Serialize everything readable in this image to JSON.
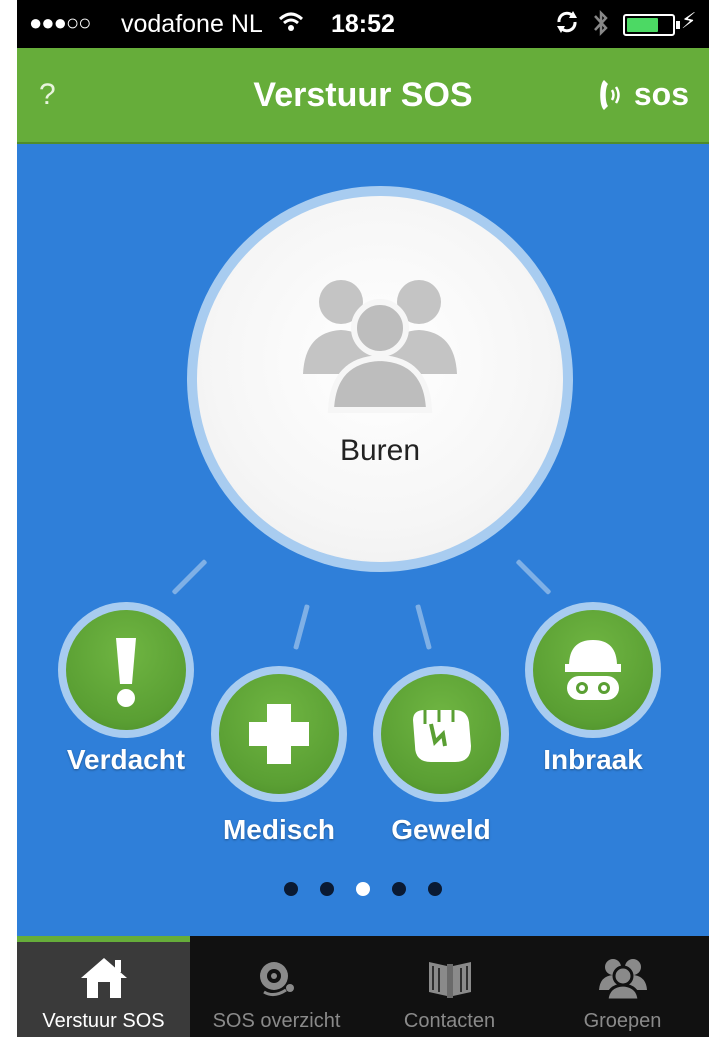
{
  "status_bar": {
    "signal": "●●●○○",
    "carrier": "vodafone NL",
    "time": "18:52",
    "battery_level": 0.7
  },
  "nav": {
    "help_label": "?",
    "title": "Verstuur SOS",
    "sos_label": "sos"
  },
  "main_target": {
    "label": "Buren",
    "icon": "group-icon"
  },
  "categories": [
    {
      "label": "Verdacht",
      "icon": "exclamation-icon"
    },
    {
      "label": "Medisch",
      "icon": "medical-cross-icon"
    },
    {
      "label": "Geweld",
      "icon": "fist-icon"
    },
    {
      "label": "Inbraak",
      "icon": "burglar-icon"
    }
  ],
  "pager": {
    "count": 5,
    "active_index": 2
  },
  "tabs": [
    {
      "label": "Verstuur SOS",
      "icon": "home-icon",
      "active": true
    },
    {
      "label": "SOS overzicht",
      "icon": "siren-icon",
      "active": false
    },
    {
      "label": "Contacten",
      "icon": "book-icon",
      "active": false
    },
    {
      "label": "Groepen",
      "icon": "group-icon",
      "active": false
    }
  ],
  "colors": {
    "accent_green": "#66ad3a",
    "background_blue": "#2f7fd9",
    "tab_bar": "#111111"
  }
}
